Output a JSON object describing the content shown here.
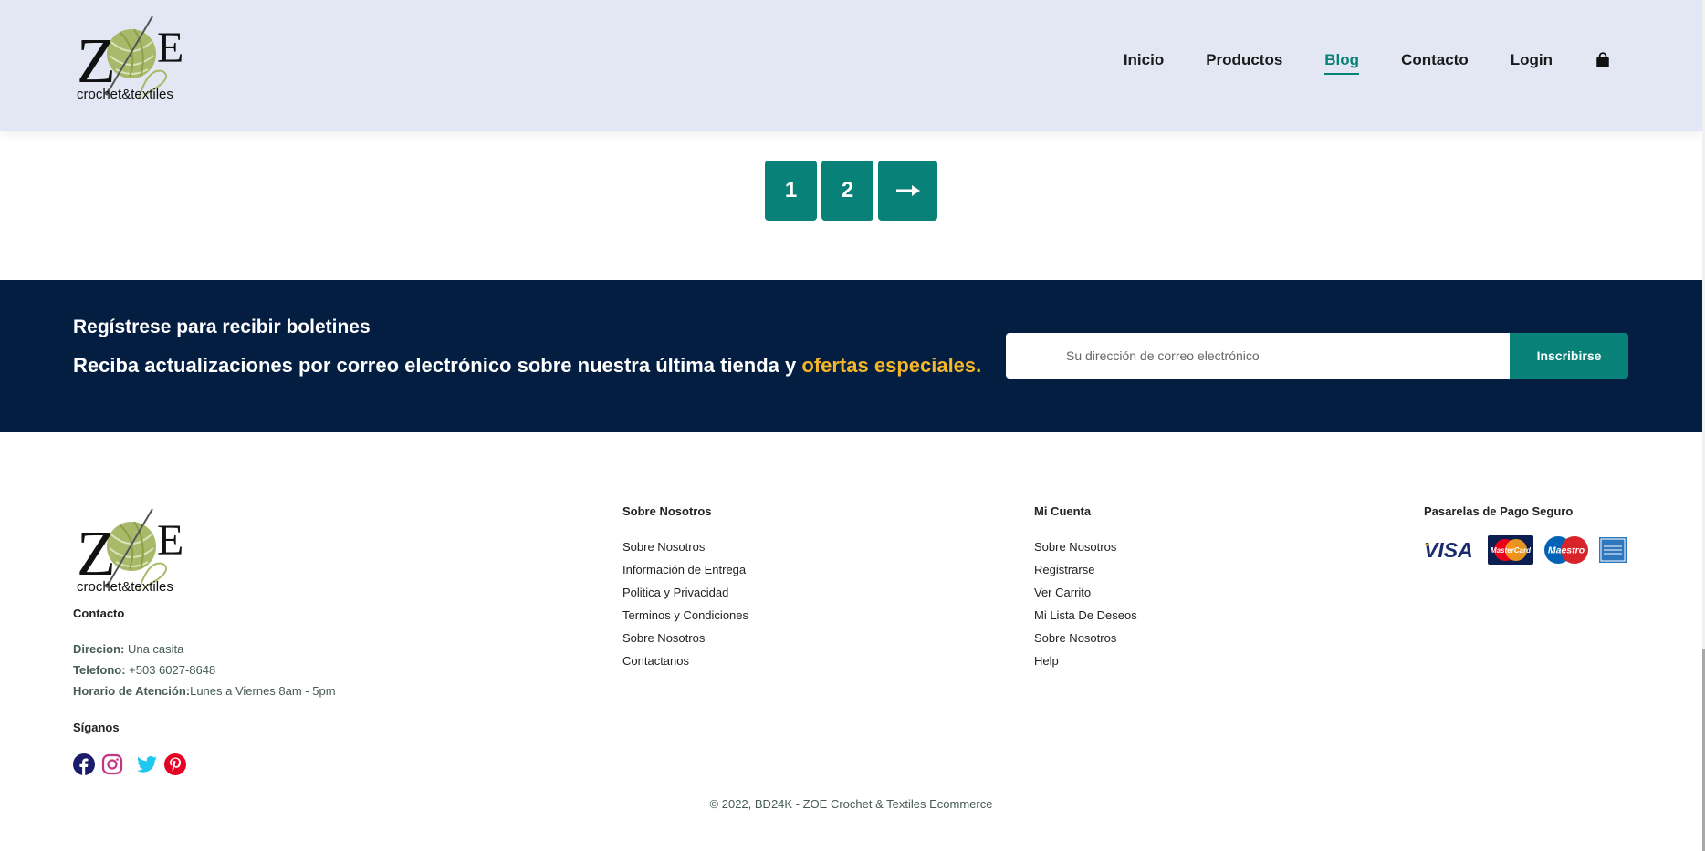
{
  "header": {
    "logo": {
      "main_letters": "ZOE",
      "tagline": "crochet&textiles"
    },
    "nav": [
      {
        "label": "Inicio",
        "active": false
      },
      {
        "label": "Productos",
        "active": false
      },
      {
        "label": "Blog",
        "active": true
      },
      {
        "label": "Contacto",
        "active": false
      },
      {
        "label": "Login",
        "active": false
      }
    ],
    "cart_icon": "shopping-bag-icon"
  },
  "pagination": {
    "pages": [
      "1",
      "2"
    ],
    "next_icon": "arrow-right-icon"
  },
  "newsletter": {
    "title": "Regístrese para recibir boletines",
    "text": "Reciba actualizaciones por correo electrónico sobre nuestra última tienda y",
    "highlight": "ofertas especiales.",
    "placeholder": "Su dirección de correo electrónico",
    "button": "Inscribirse"
  },
  "footer": {
    "contact": {
      "heading": "Contacto",
      "address_label": "Direcion:",
      "address": " Una casita",
      "phone_label": "Telefono:",
      "phone": " +503 6027-8648",
      "hours_label": "Horario de Atención:",
      "hours": "Lunes a Viernes 8am - 5pm"
    },
    "follow": {
      "heading": "Síganos",
      "networks": [
        "facebook-icon",
        "instagram-icon",
        "twitter-icon",
        "pinterest-icon"
      ]
    },
    "about": {
      "heading": "Sobre Nosotros",
      "links": [
        "Sobre Nosotros",
        "Información de Entrega",
        "Politica y Privacidad",
        "Terminos y Condiciones",
        "Sobre Nosotros",
        "Contactanos"
      ]
    },
    "account": {
      "heading": "Mi Cuenta",
      "links": [
        "Sobre Nosotros",
        "Registrarse",
        "Ver Carrito",
        "Mi Lista De Deseos",
        "Sobre Nosotros",
        "Help"
      ]
    },
    "payments": {
      "heading": "Pasarelas de Pago Seguro",
      "cards": [
        "visa-logo",
        "mastercard-logo",
        "maestro-logo",
        "amex-logo"
      ]
    },
    "copyright": "© 2022, BD24K - ZOE Crochet & Textiles Ecommerce"
  },
  "colors": {
    "accent": "#088178",
    "navy": "#041e42",
    "highlight": "#f4b628",
    "header_bg": "#e3e6f3"
  }
}
